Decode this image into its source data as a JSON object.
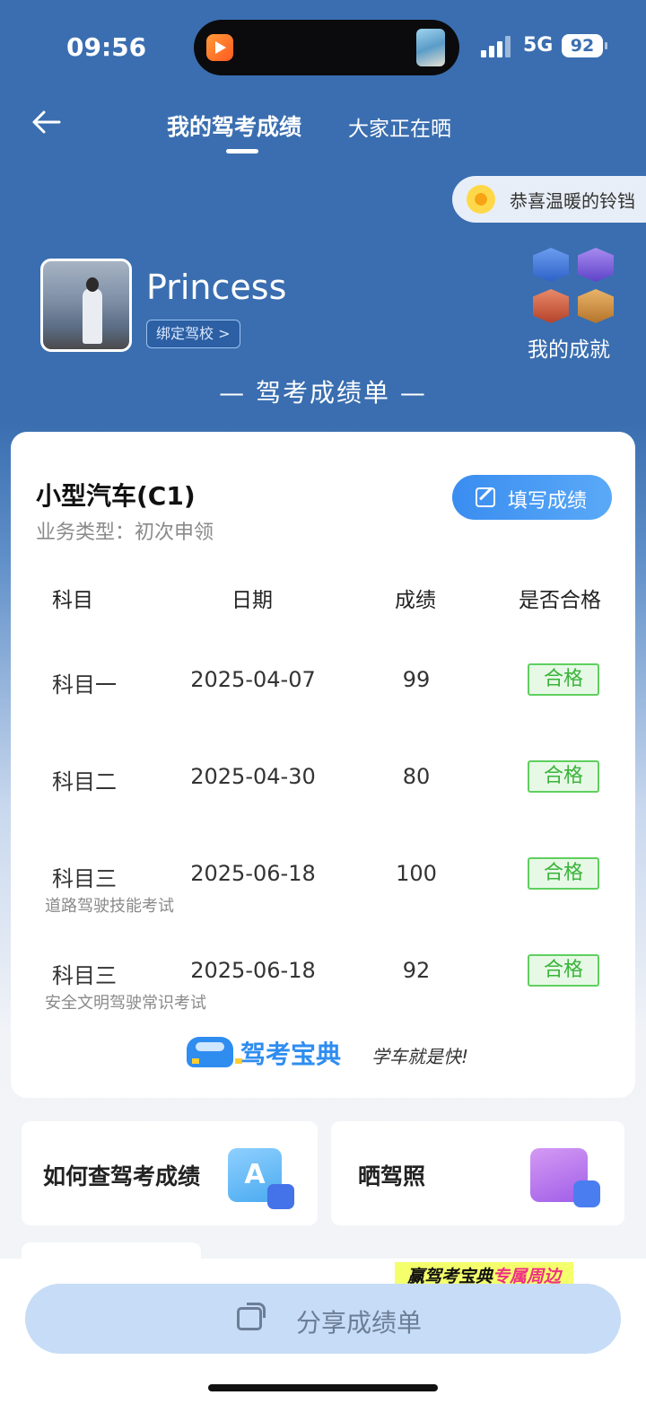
{
  "status_bar": {
    "time": "09:56",
    "network": "5G",
    "battery": "92"
  },
  "header": {
    "back_icon": "back-arrow-icon",
    "tab_active": "我的驾考成绩",
    "tab_other": "大家正在晒"
  },
  "congrats": {
    "icon": "sunflower-icon",
    "text": "恭喜温暖的铃铛"
  },
  "profile": {
    "username": "Princess",
    "bind_school": "绑定驾校 >",
    "achievements_label": "我的成就"
  },
  "sheet_title": "— 驾考成绩单 —",
  "card": {
    "vehicle": "小型汽车(C1)",
    "business_type": "业务类型：初次申领",
    "fill_button": "填写成绩",
    "headers": [
      "科目",
      "日期",
      "成绩",
      "是否合格"
    ],
    "rows": [
      {
        "subject": "科目一",
        "date": "2025-04-07",
        "score": "99",
        "status": "合格",
        "note": ""
      },
      {
        "subject": "科目二",
        "date": "2025-04-30",
        "score": "80",
        "status": "合格",
        "note": ""
      },
      {
        "subject": "科目三",
        "date": "2025-06-18",
        "score": "100",
        "status": "合格",
        "note": "道路驾驶技能考试"
      },
      {
        "subject": "科目三",
        "date": "2025-06-18",
        "score": "92",
        "status": "合格",
        "note": "安全文明驾驶常识考试"
      }
    ],
    "brand_name": "驾考宝典",
    "brand_slogan": "学车就是快!"
  },
  "tiles": [
    {
      "label": "如何查驾考成绩",
      "icon": "search-doc-icon"
    },
    {
      "label": "晒驾照",
      "icon": "photo-camera-icon"
    }
  ],
  "promo": {
    "prefix": "赢驾考宝典",
    "highlight": "专属周边"
  },
  "share_button": "分享成绩单",
  "colors": {
    "header_bg": "#3a6eb0",
    "accent": "#3a8df0",
    "pass_green": "#3ab33a"
  }
}
